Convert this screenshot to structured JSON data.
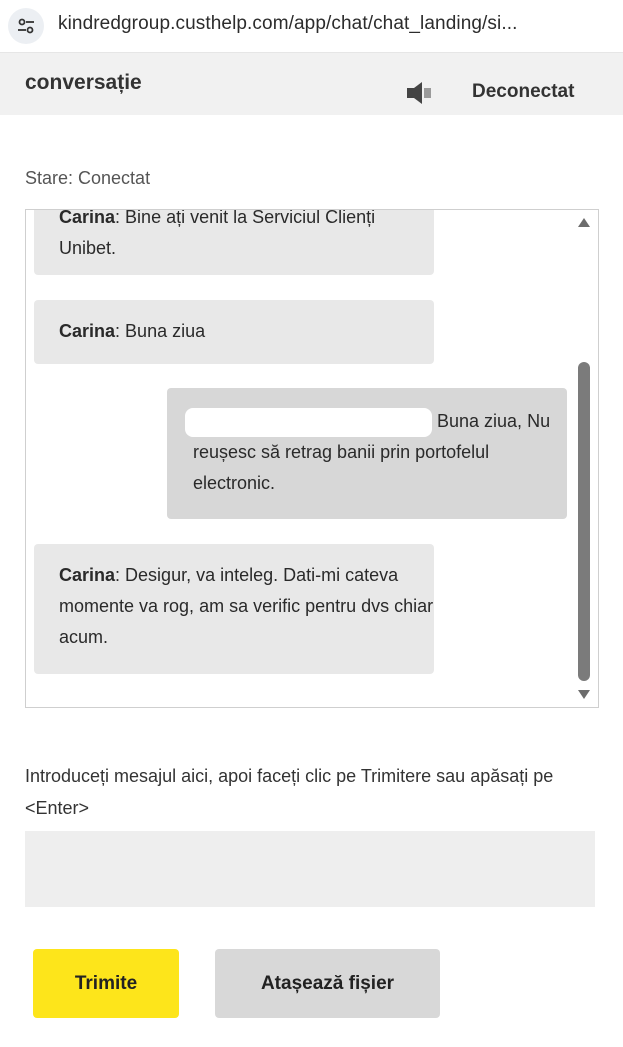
{
  "browser": {
    "url": "kindredgroup.custhelp.com/app/chat/chat_landing/si...",
    "site_info_icon": "tune-icon"
  },
  "header": {
    "title": "conversație",
    "sound_icon": "speaker-icon",
    "disconnect_label": "Deconectat"
  },
  "status": {
    "text": "Stare: Conectat"
  },
  "messages": [
    {
      "sender": "Carina",
      "separator": ": ",
      "text": "Bine ați venit la Serviciul Clienți Unibet.",
      "agent": true
    },
    {
      "sender": "Carina",
      "separator": ": ",
      "text": "Buna ziua",
      "agent": true
    },
    {
      "sender": "",
      "separator": "",
      "text_line1": "Buna ziua,",
      "text_rest": "Nu reușesc să retrag banii prin portofelul electronic.",
      "agent": false
    },
    {
      "sender": "Carina",
      "separator": ": ",
      "text": "Desigur, va inteleg. Dati-mi cateva momente va rog, am sa verific pentru dvs chiar acum.",
      "agent": true
    }
  ],
  "composer": {
    "hint": "Introduceți mesajul aici, apoi faceți clic pe Trimitere sau apăsați pe <Enter>",
    "value": ""
  },
  "buttons": {
    "send": "Trimite",
    "attach": "Atașează fișier"
  },
  "colors": {
    "send_button": "#fde51b",
    "agent_bubble": "#e8e8e8",
    "user_bubble": "#d7d7d7",
    "header_bg": "#f1f1f1"
  }
}
